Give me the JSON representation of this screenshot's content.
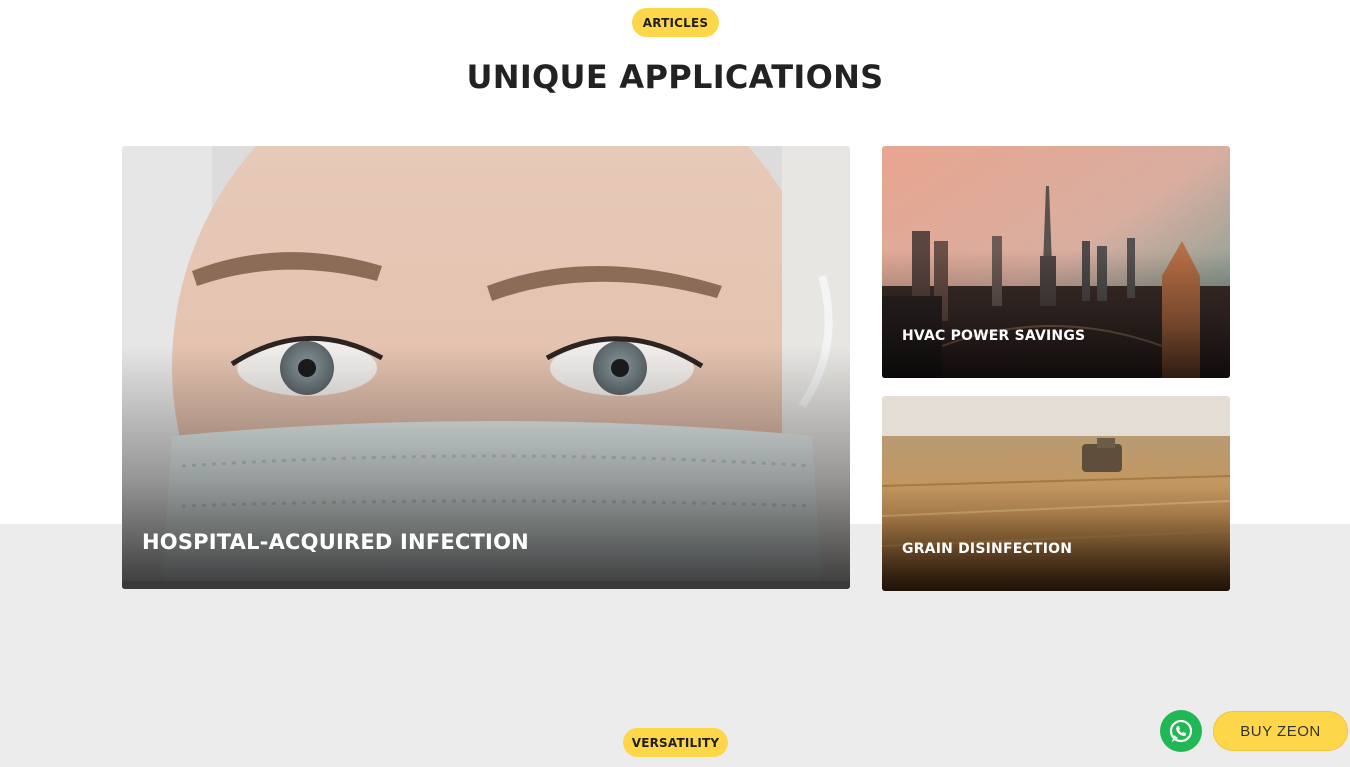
{
  "header": {
    "badge": "ARTICLES",
    "title": "UNIQUE APPLICATIONS"
  },
  "cards": [
    {
      "label": "HOSPITAL-ACQUIRED INFECTION",
      "image": "masked-face-photo"
    },
    {
      "label": "HVAC POWER SAVINGS",
      "image": "city-skyline-photo"
    },
    {
      "label": "GRAIN DISINFECTION",
      "image": "wheat-field-photo"
    }
  ],
  "next_section": {
    "badge": "VERSATILITY"
  },
  "floating": {
    "whatsapp_icon": "whatsapp-icon",
    "buy_label": "BUY ZEON"
  },
  "colors": {
    "accent": "#fdd64a",
    "whatsapp": "#1fb855",
    "band": "#ececec",
    "heading": "#222222"
  }
}
